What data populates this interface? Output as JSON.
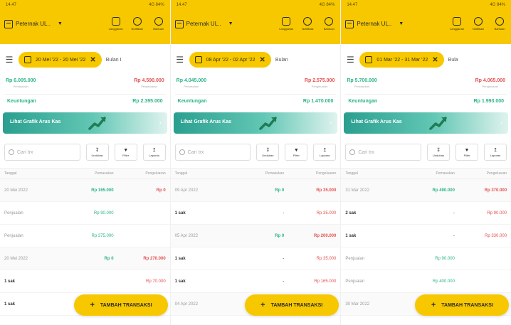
{
  "screens": [
    {
      "status": {
        "time": "14.47",
        "right": "4G 84%"
      },
      "owner": "Peternak UL..",
      "tools": [
        "Langganan",
        "Notifikasi",
        "Bantuan"
      ],
      "filter": {
        "date_range": "20 Mei '22 - 20 Mei '22",
        "tab": "Bulan I"
      },
      "summary": {
        "income": "Rp 6.005.000",
        "income_label": "Pemasukan",
        "expense": "Rp 4.590.000",
        "expense_label": "Pengeluaran",
        "profit_label": "Keuntungan",
        "profit": "Rp 2.395.000"
      },
      "banner": "Lihat Grafik Arus Kas",
      "search_placeholder": "Cari trx",
      "buttons": [
        "Unduhan",
        "Filter",
        "Laporan"
      ],
      "columns": [
        "Tanggal",
        "Pemasukan",
        "Pengeluaran"
      ],
      "rows": [
        {
          "kind": "date",
          "c1": "20 Mei 2022",
          "c2": "Rp 165.000",
          "c3": "Rp 0"
        },
        {
          "kind": "sale",
          "c1": "Penjualan",
          "c2": "Rp 90.000",
          "c3": ""
        },
        {
          "kind": "sale",
          "c1": "Penjualan",
          "c2": "Rp 375.000",
          "c3": ""
        },
        {
          "kind": "date",
          "c1": "20 Mei 2022",
          "c2": "Rp 0",
          "c3": "Rp 270.000"
        },
        {
          "kind": "item",
          "c1": "1 sak",
          "c2": "",
          "c3": "Rp 70.000"
        },
        {
          "kind": "item",
          "c1": "1 sak",
          "c2": "",
          "c3": ""
        }
      ]
    },
    {
      "status": {
        "time": "14.47",
        "right": "4G 84%"
      },
      "owner": "Peternak UL..",
      "tools": [
        "Langganan",
        "Notifikasi",
        "Bantuan"
      ],
      "filter": {
        "date_range": "08 Apr '22 - 02 Apr '22",
        "tab": "Bulan"
      },
      "summary": {
        "income": "Rp 4.045.000",
        "income_label": "Pemasukan",
        "expense": "Rp 2.575.000",
        "expense_label": "Pengeluaran",
        "profit_label": "Keuntungan",
        "profit": "Rp 1.470.000"
      },
      "banner": "Lihat Grafik Arus Kas",
      "search_placeholder": "Cari trx",
      "buttons": [
        "Unduhan",
        "Filter",
        "Laporan"
      ],
      "columns": [
        "Tanggal",
        "Pemasukan",
        "Pengeluaran"
      ],
      "rows": [
        {
          "kind": "date",
          "c1": "09 Apr 2022",
          "c2": "Rp 0",
          "c3": "Rp 35.000"
        },
        {
          "kind": "item",
          "c1": "1 sak",
          "c2": "-",
          "c3": "Rp 35.000"
        },
        {
          "kind": "date",
          "c1": "05 Apr 2022",
          "c2": "Rp 0",
          "c3": "Rp 200.000"
        },
        {
          "kind": "item",
          "c1": "1 sak",
          "c2": "-",
          "c3": "Rp 35.000"
        },
        {
          "kind": "item",
          "c1": "1 sak",
          "c2": "-",
          "c3": "Rp 165.000"
        },
        {
          "kind": "date",
          "c1": "04 Apr 2022",
          "c2": "Rp 400.000",
          "c3": ""
        }
      ]
    },
    {
      "status": {
        "time": "14.47",
        "right": "4G 84%"
      },
      "owner": "Peternak UL..",
      "tools": [
        "Langganan",
        "Notifikasi",
        "Bantuan"
      ],
      "filter": {
        "date_range": "01 Mar '22 - 31 Mar '22",
        "tab": "Bula"
      },
      "summary": {
        "income": "Rp 5.700.000",
        "income_label": "Pemasukan",
        "expense": "Rp 4.065.000",
        "expense_label": "Pengeluaran",
        "profit_label": "Keuntungan",
        "profit": "Rp 1.993.000"
      },
      "banner": "Lihat Grafik Arus Kas",
      "search_placeholder": "Cari trx",
      "buttons": [
        "Unduhan",
        "Filter",
        "Laporan"
      ],
      "columns": [
        "Tanggal",
        "Pemasukan",
        "Pengeluaran"
      ],
      "rows": [
        {
          "kind": "date",
          "c1": "31 Mar 2022",
          "c2": "Rp 490.000",
          "c3": "Rp 370.000"
        },
        {
          "kind": "item",
          "c1": "2 sak",
          "c2": "-",
          "c3": "Rp 90.000"
        },
        {
          "kind": "item",
          "c1": "1 sak",
          "c2": "-",
          "c3": "Rp 330.000"
        },
        {
          "kind": "sale",
          "c1": "Penjualan",
          "c2": "Rp 90.000",
          "c3": ""
        },
        {
          "kind": "sale",
          "c1": "Penjualan",
          "c2": "Rp 400.000",
          "c3": ""
        },
        {
          "kind": "date",
          "c1": "30 Mar 2022",
          "c2": "Rp 0",
          "c3": ""
        }
      ]
    }
  ],
  "fab_label": "TAMBAH TRANSAKSI",
  "colors": {
    "brand": "#f7c800",
    "income": "#2bb38a",
    "expense": "#e35050"
  }
}
